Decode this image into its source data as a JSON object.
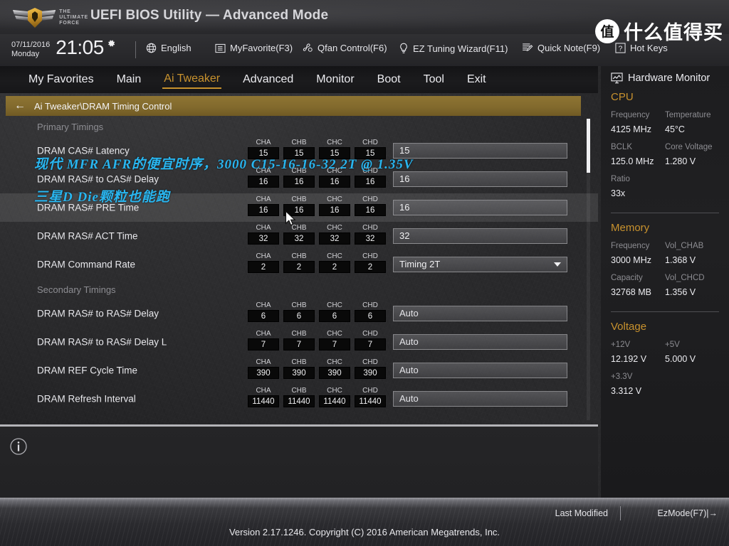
{
  "header": {
    "title": "UEFI BIOS Utility — Advanced Mode",
    "logo_line1": "THE",
    "logo_line2": "ULTIMATE",
    "logo_line3": "FORCE"
  },
  "toolbar": {
    "date": "07/11/2016",
    "day": "Monday",
    "time": "21:05",
    "gear_icon": "gear-icon",
    "items": [
      {
        "label": "English",
        "icon": "globe-icon"
      },
      {
        "label": "MyFavorite(F3)",
        "icon": "list-icon"
      },
      {
        "label": "Qfan Control(F6)",
        "icon": "fan-icon"
      },
      {
        "label": "EZ Tuning Wizard(F11)",
        "icon": "bulb-icon"
      },
      {
        "label": "Quick Note(F9)",
        "icon": "note-icon"
      },
      {
        "label": "Hot Keys",
        "icon": "question-icon"
      }
    ]
  },
  "nav": {
    "tabs": [
      {
        "label": "My Favorites",
        "active": false
      },
      {
        "label": "Main",
        "active": false
      },
      {
        "label": "Ai Tweaker",
        "active": true
      },
      {
        "label": "Advanced",
        "active": false
      },
      {
        "label": "Monitor",
        "active": false
      },
      {
        "label": "Boot",
        "active": false
      },
      {
        "label": "Tool",
        "active": false
      },
      {
        "label": "Exit",
        "active": false
      }
    ],
    "active_color": "#c8922e"
  },
  "breadcrumb": {
    "back_icon": "back-arrow-icon",
    "path": "Ai Tweaker\\DRAM Timing Control"
  },
  "annotations": [
    {
      "text": "现代 MFR AFR的便宜时序，3000 C15-16-16-32 2T @ 1.35V",
      "color": "#29b6f0"
    },
    {
      "text": "三星D Die颗粒也能跑",
      "color": "#29b6f0"
    }
  ],
  "channels": [
    "CHA",
    "CHB",
    "CHC",
    "CHD"
  ],
  "sections": [
    {
      "title": "Primary Timings",
      "rows": [
        {
          "label": "DRAM CAS# Latency",
          "ch": [
            "15",
            "15",
            "15",
            "15"
          ],
          "value": "15",
          "type": "input",
          "highlight": false
        },
        {
          "label": "DRAM RAS# to CAS# Delay",
          "ch": [
            "16",
            "16",
            "16",
            "16"
          ],
          "value": "16",
          "type": "input",
          "highlight": false
        },
        {
          "label": "DRAM RAS# PRE Time",
          "ch": [
            "16",
            "16",
            "16",
            "16"
          ],
          "value": "16",
          "type": "input",
          "highlight": true
        },
        {
          "label": "DRAM RAS# ACT Time",
          "ch": [
            "32",
            "32",
            "32",
            "32"
          ],
          "value": "32",
          "type": "input",
          "highlight": false
        },
        {
          "label": "DRAM Command Rate",
          "ch": [
            "2",
            "2",
            "2",
            "2"
          ],
          "value": "Timing 2T",
          "type": "select",
          "highlight": false
        }
      ]
    },
    {
      "title": "Secondary Timings",
      "rows": [
        {
          "label": "DRAM RAS# to RAS# Delay",
          "ch": [
            "6",
            "6",
            "6",
            "6"
          ],
          "value": "Auto",
          "type": "input",
          "highlight": false
        },
        {
          "label": "DRAM RAS# to RAS# Delay L",
          "ch": [
            "7",
            "7",
            "7",
            "7"
          ],
          "value": "Auto",
          "type": "input",
          "highlight": false
        },
        {
          "label": "DRAM REF Cycle Time",
          "ch": [
            "390",
            "390",
            "390",
            "390"
          ],
          "value": "Auto",
          "type": "input",
          "highlight": false
        },
        {
          "label": "DRAM Refresh Interval",
          "ch": [
            "11440",
            "11440",
            "11440",
            "11440"
          ],
          "value": "Auto",
          "type": "input",
          "highlight": false
        }
      ]
    }
  ],
  "hwmon": {
    "title": "Hardware Monitor",
    "icon": "monitor-icon",
    "groups": [
      {
        "name": "CPU",
        "pairs": [
          {
            "k1": "Frequency",
            "v1": "4125 MHz",
            "k2": "Temperature",
            "v2": "45°C"
          },
          {
            "k1": "BCLK",
            "v1": "125.0 MHz",
            "k2": "Core Voltage",
            "v2": "1.280 V"
          },
          {
            "k1": "Ratio",
            "v1": "33x",
            "k2": "",
            "v2": ""
          }
        ]
      },
      {
        "name": "Memory",
        "pairs": [
          {
            "k1": "Frequency",
            "v1": "3000 MHz",
            "k2": "Vol_CHAB",
            "v2": "1.368 V"
          },
          {
            "k1": "Capacity",
            "v1": "32768 MB",
            "k2": "Vol_CHCD",
            "v2": "1.356 V"
          }
        ]
      },
      {
        "name": "Voltage",
        "pairs": [
          {
            "k1": "+12V",
            "v1": "12.192 V",
            "k2": "+5V",
            "v2": "5.000 V"
          },
          {
            "k1": "+3.3V",
            "v1": "3.312 V",
            "k2": "",
            "v2": ""
          }
        ]
      }
    ],
    "accent_color": "#c8922e"
  },
  "footer": {
    "version": "Version 2.17.1246. Copyright (C) 2016 American Megatrends, Inc.",
    "last_modified": "Last Modified",
    "ezmode": "EzMode(F7)|→"
  },
  "watermark": {
    "badge": "值",
    "text": "什么值得买"
  },
  "info_icon": "info-icon"
}
